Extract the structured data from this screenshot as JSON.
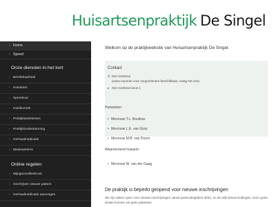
{
  "header": {
    "logo_part1": "Huisartsenpraktijk",
    "logo_part2": "De Singel"
  },
  "sidebar": {
    "top_items": [
      {
        "label": "Home",
        "active": true
      },
      {
        "label": "Spoed",
        "active": false
      }
    ],
    "section1_title": "Onze diensten in het kort",
    "section1_items": [
      "Bereikbaarheid",
      "Huisarten",
      "Spreekuur",
      "Huisbezoek",
      "Praktijkassistentes",
      "Praktijkondersteuning",
      "Herhaalmedicatie",
      "Medewerkers"
    ],
    "section2_title": "Online regelen",
    "section2_items": [
      "Mijngezondheid.net",
      "Inschrijven nieuwe patient",
      "Herhaalmedicatie aanvragen"
    ]
  },
  "main": {
    "welcome": "Welkom op de praktijkwebsite van Huisartsenpraktijk De Singel.",
    "contact": {
      "title": "Contact",
      "phone1": "010-4125312",
      "phone1_note": "(extra nummer voor zorgverleners beschikbaar, vraag het ons)",
      "phone2": "010-4125312 keus 1"
    },
    "doctors_label": "Huisartsen:",
    "doctors": [
      "Mevrouw T.L. Boutkan",
      "Mevrouw L.E. van Gorp",
      "Mevrouw M.B. van Doorn"
    ],
    "acting_label": "Waarnemend huisarts:",
    "acting": [
      "Mevrouw W. van der Gaag"
    ],
    "notice_title": "De praktijk is beperkt geopend voor nieuwe inschrijvingen",
    "notice_text": "We zijn alleen open voor nieuwe inschrijvingen vanuit postcodegebied 3034, en de wijk Nieuw Kralingen. Door grote drukte kunnen we geen patiënten"
  },
  "colors": {
    "brand_green": "#1f9a58",
    "sidebar_bg": "#202020",
    "contact_bg": "#eef2ee"
  },
  "icons": {
    "nav_chevron": "chevron-right-icon",
    "phone": "phone-icon",
    "phone_alt": "phone-menu-icon"
  }
}
